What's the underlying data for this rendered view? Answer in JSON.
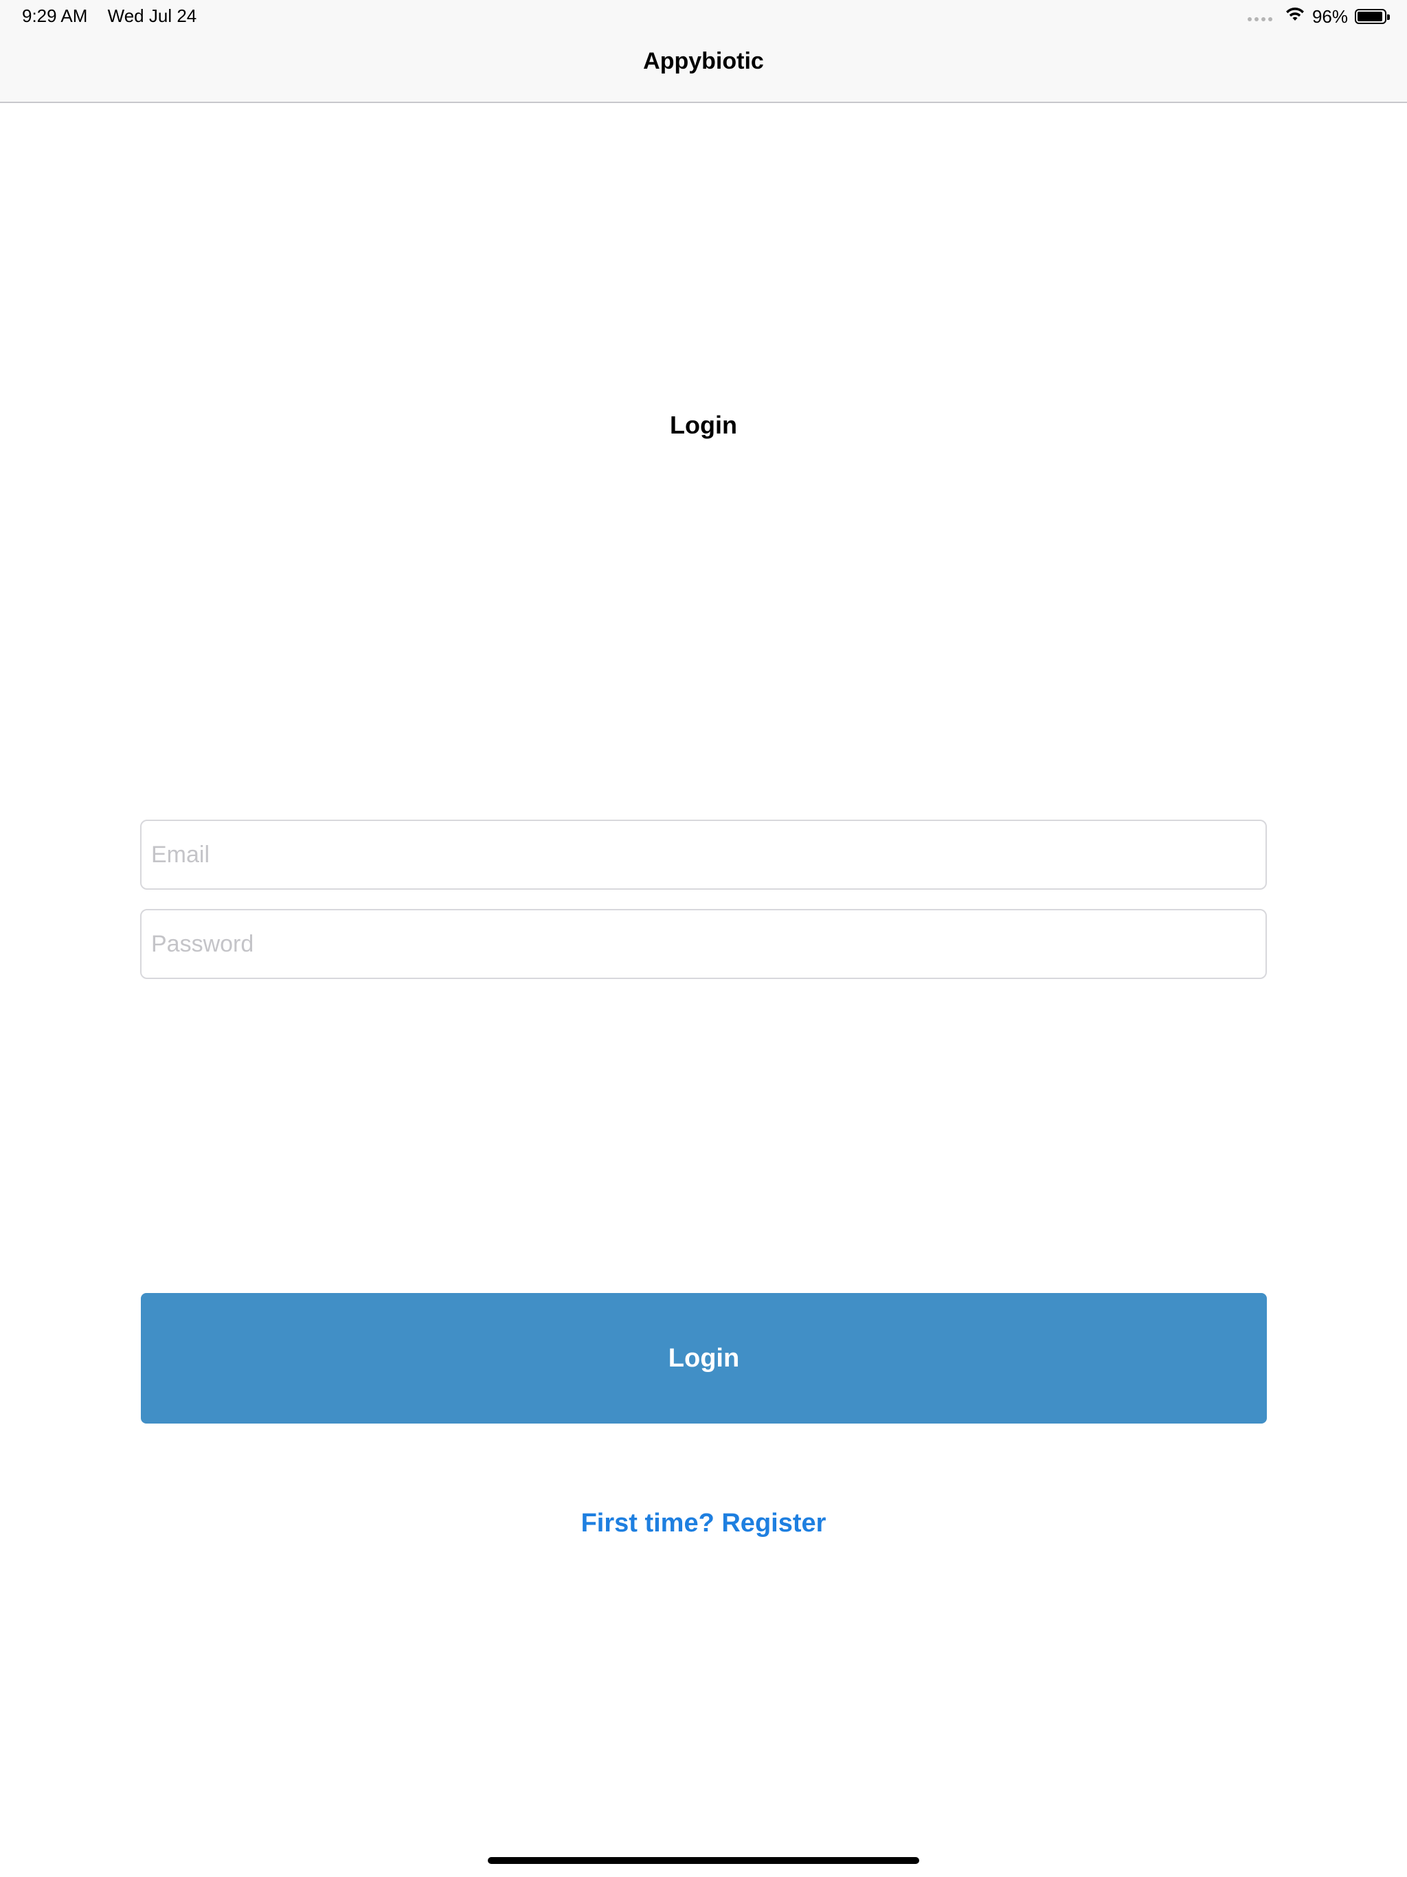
{
  "status_bar": {
    "time": "9:29 AM",
    "date": "Wed Jul 24",
    "battery_percent": "96%",
    "battery_level": 0.96,
    "signal_icon": "cellular-signal-icon",
    "wifi_icon": "wifi-icon",
    "battery_icon": "battery-icon"
  },
  "nav": {
    "title": "Appybiotic"
  },
  "page": {
    "heading": "Login"
  },
  "form": {
    "email": {
      "placeholder": "Email",
      "value": ""
    },
    "password": {
      "placeholder": "Password",
      "value": ""
    },
    "submit_label": "Login",
    "register_link": "First time? Register"
  },
  "colors": {
    "button": "#418fc6",
    "link": "#1e7fe0",
    "nav_background": "#f8f8f8"
  }
}
